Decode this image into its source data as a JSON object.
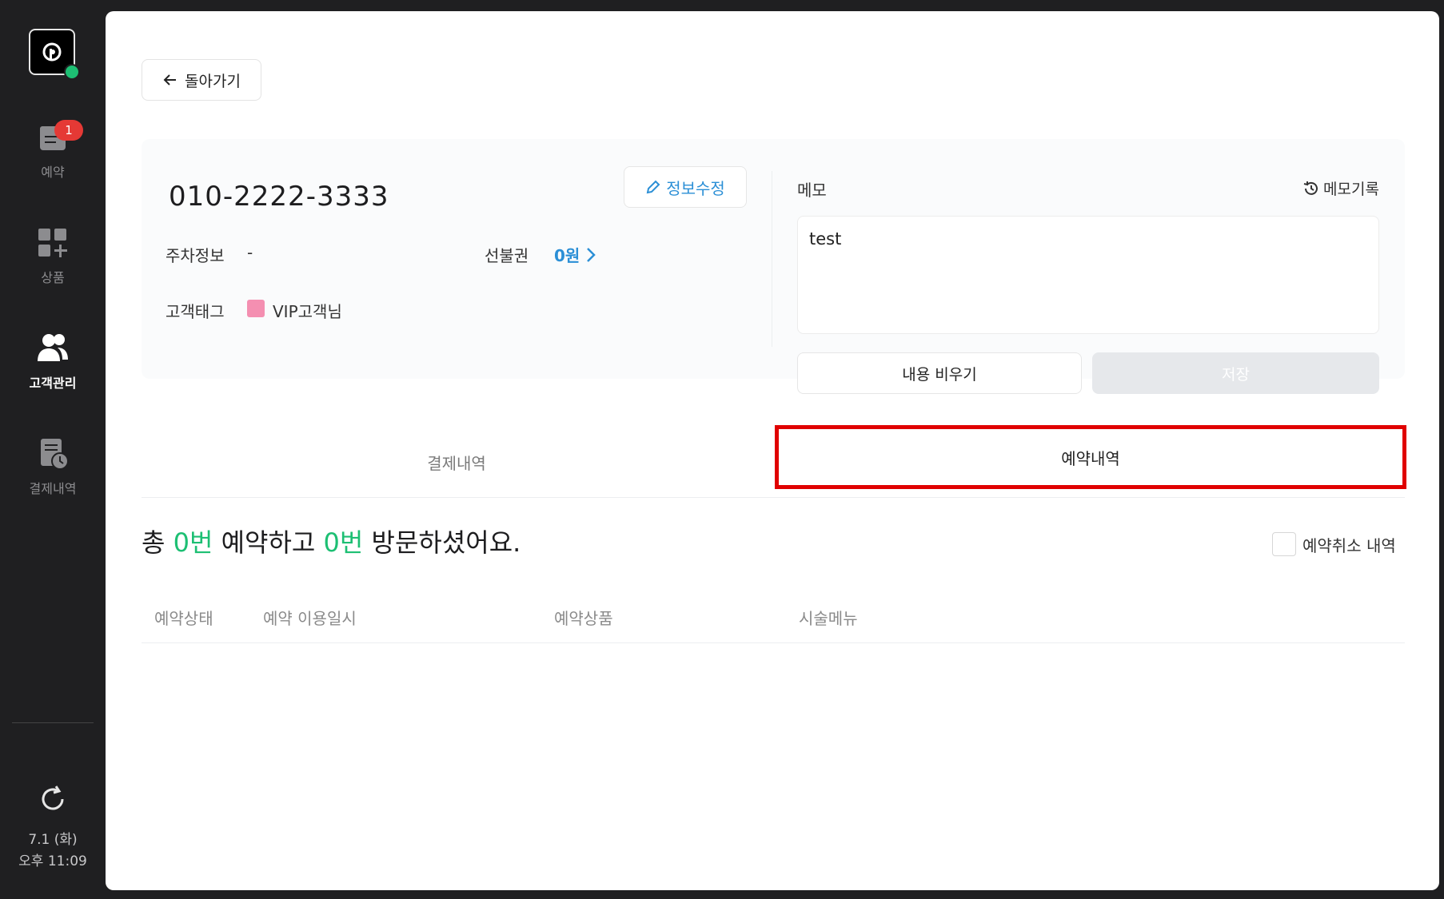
{
  "sidebar": {
    "badge_count": "1",
    "items": [
      {
        "label": "예약",
        "icon": "calendar-icon"
      },
      {
        "label": "상품",
        "icon": "grid-plus-icon"
      },
      {
        "label": "고객관리",
        "icon": "users-icon"
      },
      {
        "label": "결제내역",
        "icon": "receipt-clock-icon"
      }
    ],
    "date": "7.1 (화)",
    "time": "오후 11:09"
  },
  "header": {
    "back_label": "돌아가기"
  },
  "customer": {
    "phone": "010-2222-3333",
    "edit_label": "정보수정",
    "parking_label": "주차정보",
    "parking_value": "-",
    "prepaid_label": "선불권",
    "prepaid_value": "0원",
    "tag_label": "고객태그",
    "tag_value": "VIP고객님",
    "tag_color": "#f48fb1"
  },
  "memo": {
    "label": "메모",
    "history_label": "메모기록",
    "value": "test",
    "clear_label": "내용 비우기",
    "save_label": "저장"
  },
  "tabs": [
    {
      "label": "결제내역",
      "active": false
    },
    {
      "label": "예약내역",
      "active": true
    }
  ],
  "summary": {
    "prefix": "총 ",
    "reservations": "0번",
    "middle": " 예약하고 ",
    "visits": "0번",
    "suffix": " 방문하셨어요.",
    "cancel_label": "예약취소 내역"
  },
  "table": {
    "columns": [
      "예약상태",
      "예약 이용일시",
      "예약상품",
      "시술메뉴"
    ]
  },
  "colors": {
    "accent_green": "#1dbf73",
    "accent_blue": "#2b8fd6",
    "highlight_red": "#e00000"
  }
}
